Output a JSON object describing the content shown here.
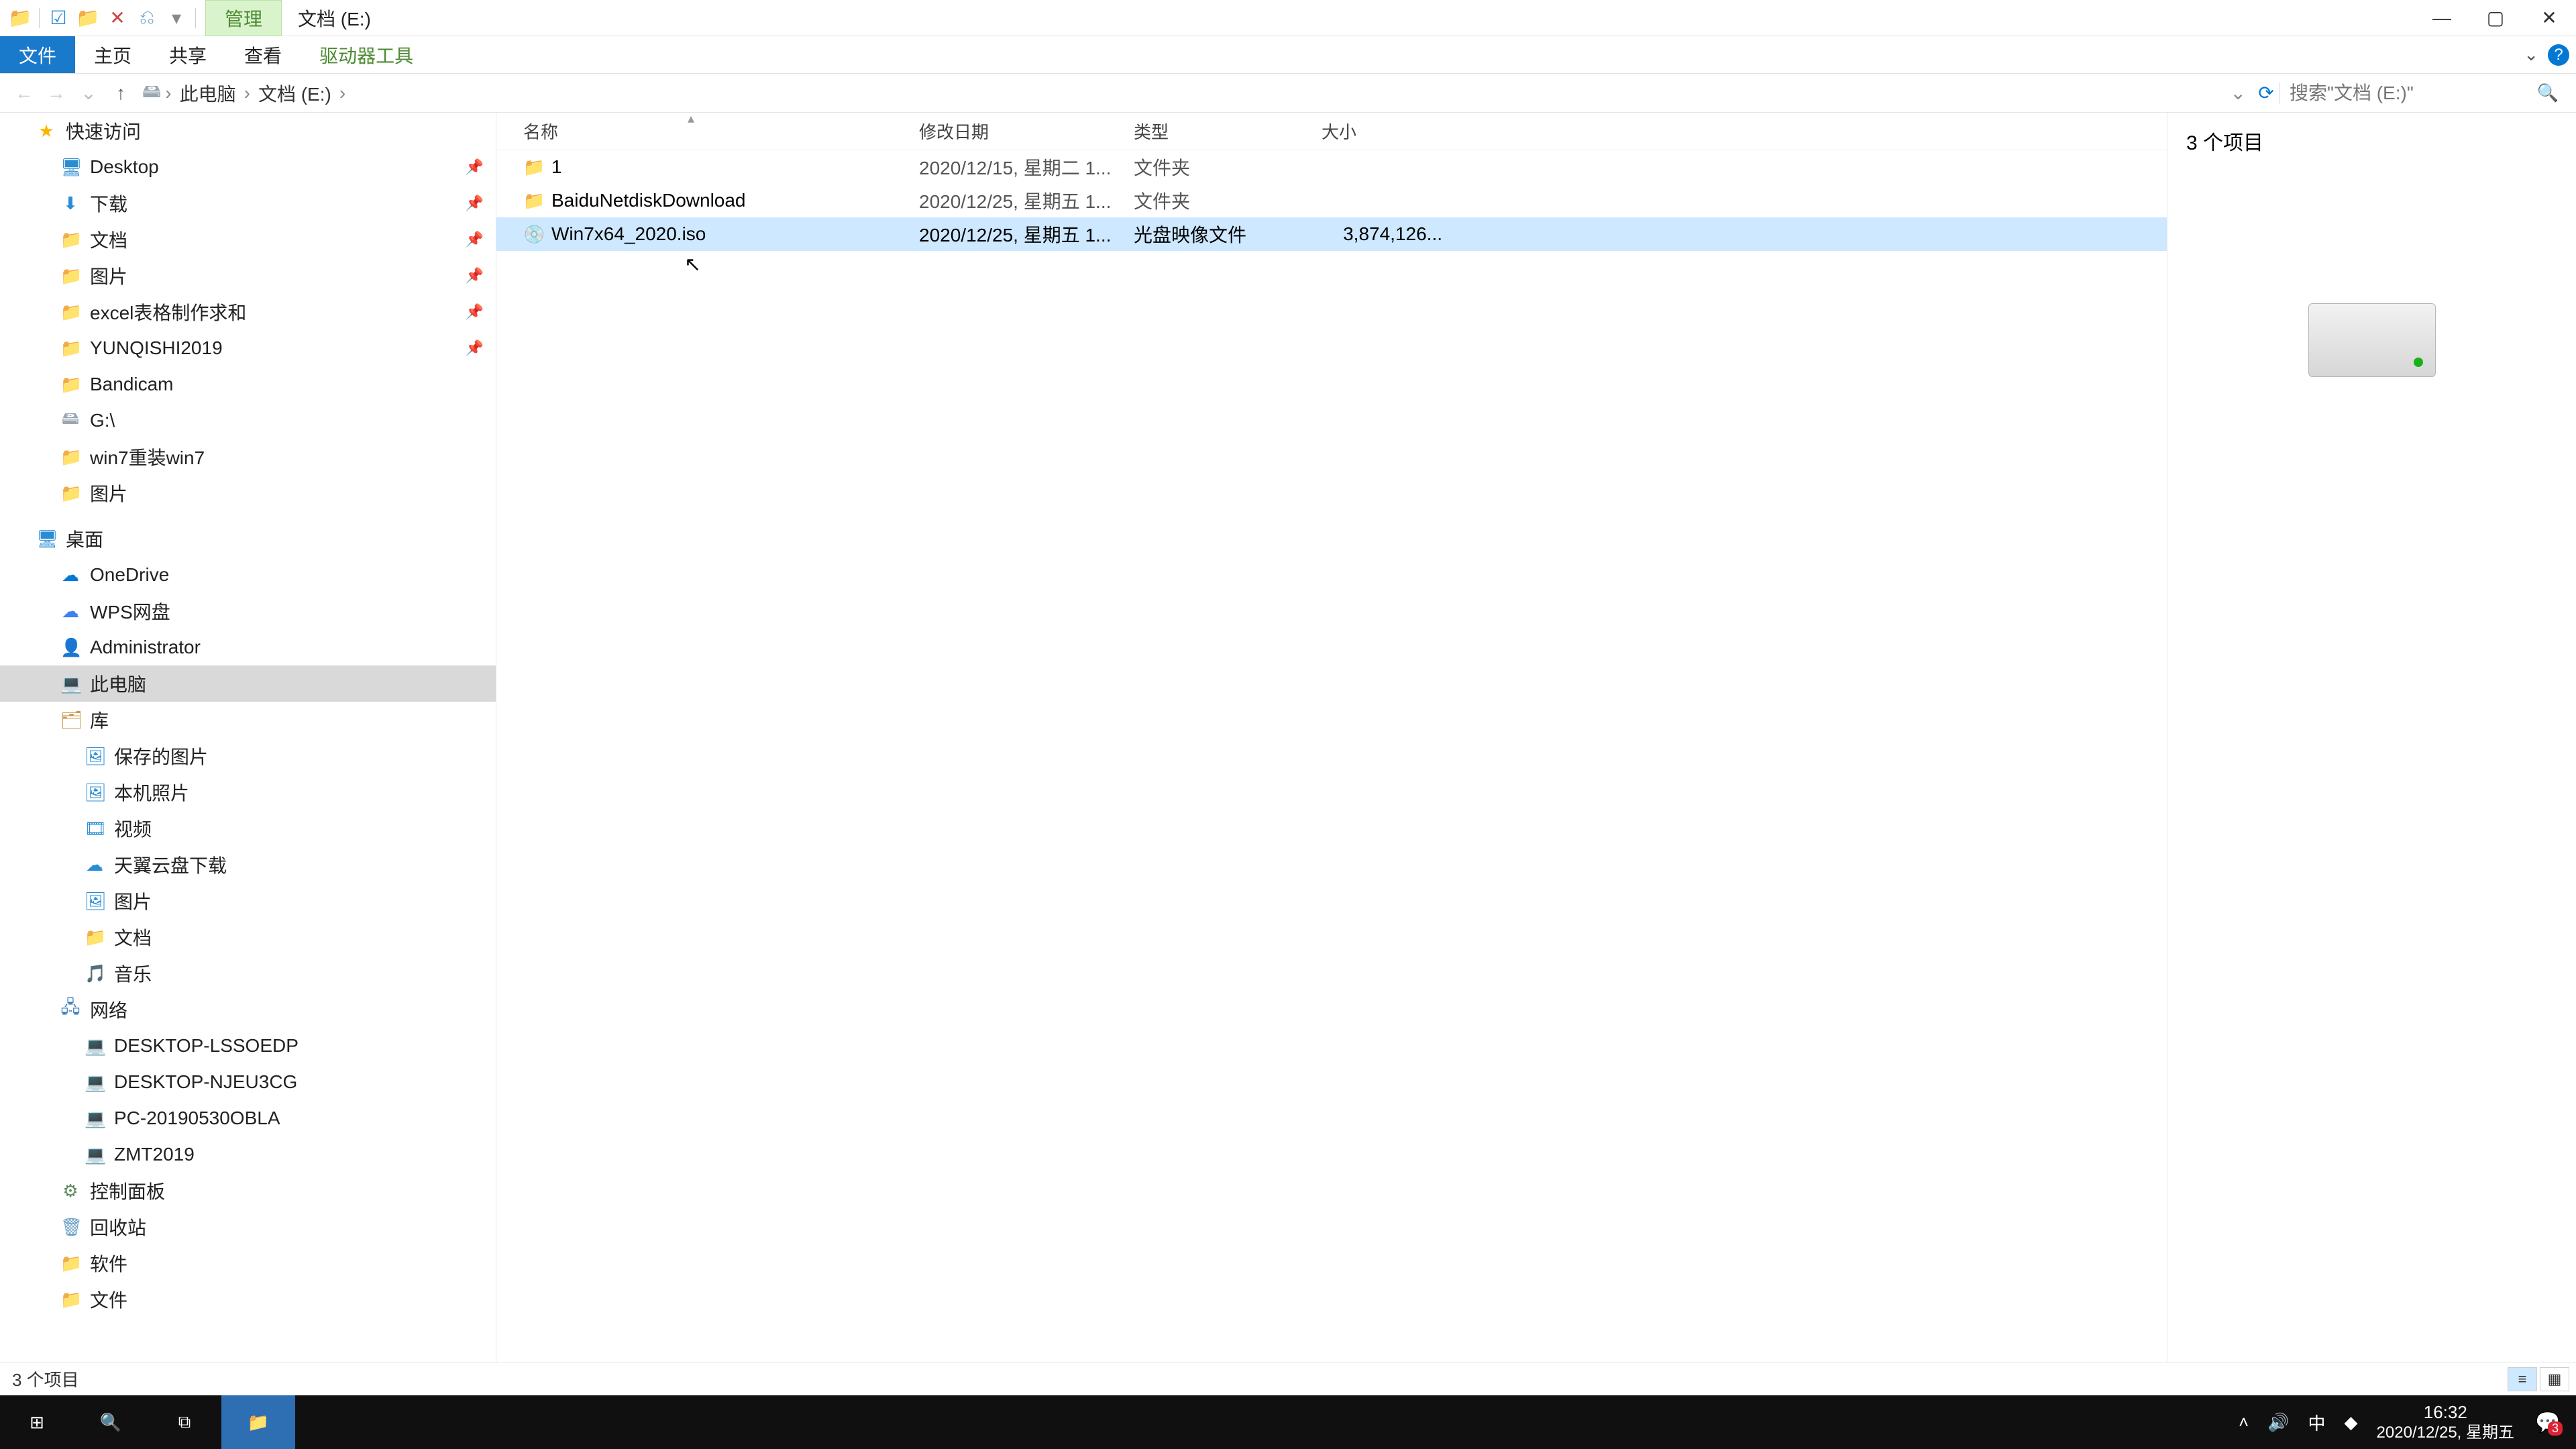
{
  "title": {
    "manage_tab": "管理",
    "window_title": "文档 (E:)"
  },
  "ribbon": {
    "file": "文件",
    "home": "主页",
    "share": "共享",
    "view": "查看",
    "drive_tools": "驱动器工具"
  },
  "address": {
    "back": "←",
    "forward": "→",
    "up": "↑",
    "crumbs": [
      "此电脑",
      "文档 (E:)"
    ],
    "search_placeholder": "搜索\"文档 (E:)\""
  },
  "nav": {
    "quick_access": "快速访问",
    "quick_items": [
      {
        "icon": "desk",
        "label": "Desktop",
        "pinned": true
      },
      {
        "icon": "blue",
        "label": "下载",
        "pinned": true
      },
      {
        "icon": "folder",
        "label": "文档",
        "pinned": true
      },
      {
        "icon": "folder",
        "label": "图片",
        "pinned": true
      },
      {
        "icon": "folder",
        "label": "excel表格制作求和",
        "pinned": true
      },
      {
        "icon": "folder",
        "label": "YUNQISHI2019",
        "pinned": true
      },
      {
        "icon": "folder",
        "label": "Bandicam",
        "pinned": false
      },
      {
        "icon": "disk",
        "label": "G:\\",
        "pinned": false
      },
      {
        "icon": "folder",
        "label": "win7重装win7",
        "pinned": false
      },
      {
        "icon": "folder",
        "label": "图片",
        "pinned": false
      }
    ],
    "desktop": "桌面",
    "desktop_items": [
      {
        "icon": "cloud",
        "label": "OneDrive"
      },
      {
        "icon": "wps",
        "label": "WPS网盘"
      },
      {
        "icon": "user",
        "label": "Administrator"
      },
      {
        "icon": "pc",
        "label": "此电脑",
        "selected": true
      },
      {
        "icon": "lib",
        "label": "库"
      }
    ],
    "lib_items": [
      {
        "label": "保存的图片"
      },
      {
        "label": "本机照片"
      },
      {
        "label": "视频"
      },
      {
        "label": "天翼云盘下载"
      },
      {
        "label": "图片"
      },
      {
        "label": "文档"
      },
      {
        "label": "音乐"
      }
    ],
    "network": "网络",
    "network_items": [
      {
        "label": "DESKTOP-LSSOEDP"
      },
      {
        "label": "DESKTOP-NJEU3CG"
      },
      {
        "label": "PC-20190530OBLA"
      },
      {
        "label": "ZMT2019"
      }
    ],
    "control_panel": "控制面板",
    "recycle": "回收站",
    "software": "软件",
    "docs": "文件"
  },
  "columns": {
    "name": "名称",
    "date": "修改日期",
    "type": "类型",
    "size": "大小"
  },
  "files": [
    {
      "icon": "folder",
      "name": "1",
      "date": "2020/12/15, 星期二 1...",
      "type": "文件夹",
      "size": ""
    },
    {
      "icon": "folder",
      "name": "BaiduNetdiskDownload",
      "date": "2020/12/25, 星期五 1...",
      "type": "文件夹",
      "size": ""
    },
    {
      "icon": "iso",
      "name": "Win7x64_2020.iso",
      "date": "2020/12/25, 星期五 1...",
      "type": "光盘映像文件",
      "size": "3,874,126...",
      "selected": true
    }
  ],
  "preview": {
    "count_label": "3 个项目"
  },
  "status": {
    "count_label": "3 个项目"
  },
  "tray": {
    "ime": "中",
    "time": "16:32",
    "date": "2020/12/25, 星期五",
    "notif_badge": "3"
  }
}
